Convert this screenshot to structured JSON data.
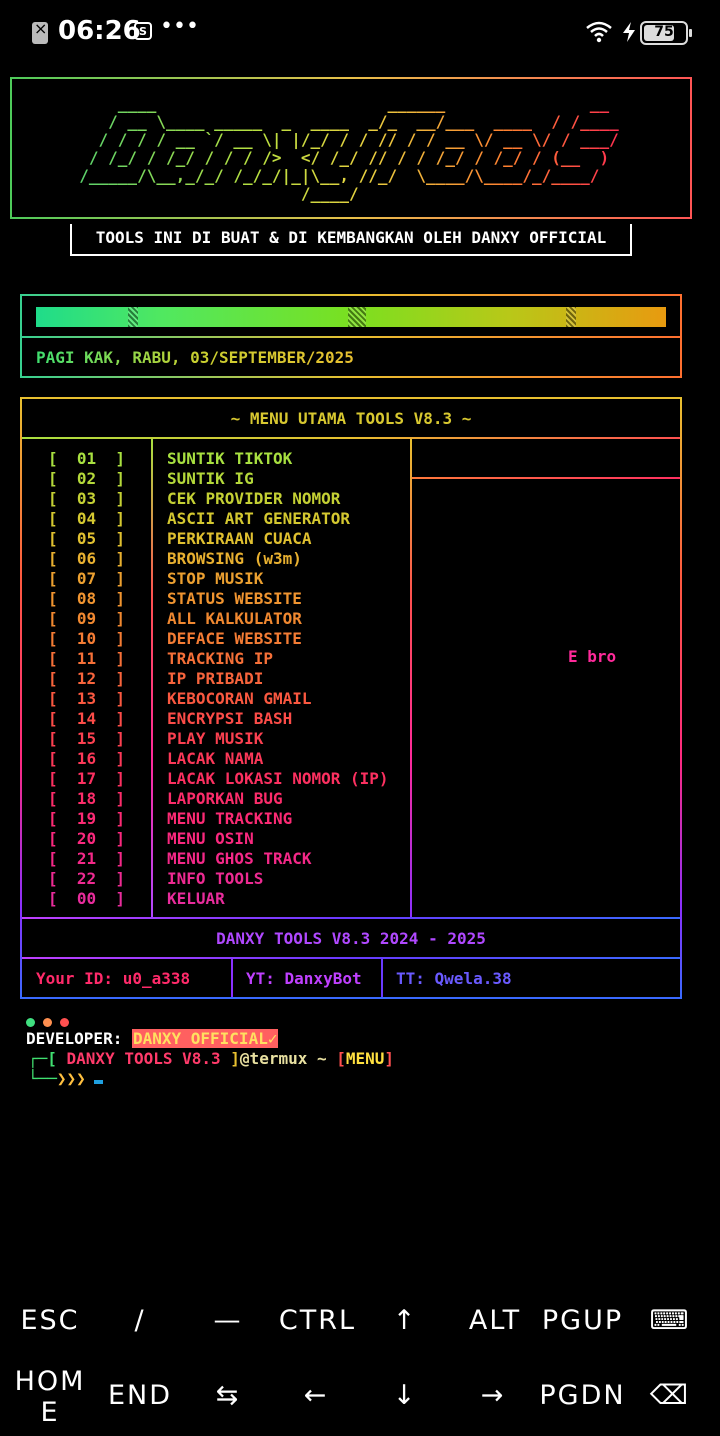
{
  "status_bar": {
    "time": "06:26",
    "more": "•••",
    "battery": "75"
  },
  "banner": {
    "ascii": "      ____                        ______               __\n     / __ \\____ _____  _  ____  _/_  __/___  ____  / /____\n    / / / / __ `/ __ \\| |/_/ / / // / / __ \\/ __ \\/ / ___/\n   / /_/ / /_/ / / / />  </ /_/ // / / /_/ / /_/ / (__  )\n  /_____/\\__,_/_/ /_/_/|_|\\__, //_/  \\____/\\____/_/____/\n                         /____/",
    "credit": "TOOLS INI DI BUAT & DI KEMBANGKAN OLEH DANXY OFFICIAL"
  },
  "greeting": "PAGI KAK, RABU, 03/SEPTEMBER/2025",
  "menu": {
    "title": "~ MENU UTAMA TOOLS V8.3 ~",
    "side_text": "E bro",
    "items": [
      {
        "num": "[  01  ]",
        "label": "SUNTIK TIKTOK",
        "color": "#a8e040"
      },
      {
        "num": "[  02  ]",
        "label": "SUNTIK IG",
        "color": "#b4d83a"
      },
      {
        "num": "[  03  ]",
        "label": "CEK PROVIDER NOMOR",
        "color": "#c4d034"
      },
      {
        "num": "[  04  ]",
        "label": "ASCII ART GENERATOR",
        "color": "#d4c830"
      },
      {
        "num": "[  05  ]",
        "label": "PERKIRAAN CUACA",
        "color": "#e0c030"
      },
      {
        "num": "[  06  ]",
        "label": "BROWSING (w3m)",
        "color": "#e8b030"
      },
      {
        "num": "[  07  ]",
        "label": "STOP MUSIK",
        "color": "#eca030"
      },
      {
        "num": "[  08  ]",
        "label": "STATUS WEBSITE",
        "color": "#f09430"
      },
      {
        "num": "[  09  ]",
        "label": "ALL KALKULATOR",
        "color": "#f08830"
      },
      {
        "num": "[  10  ]",
        "label": "DEFACE WEBSITE",
        "color": "#f47c34"
      },
      {
        "num": "[  11  ]",
        "label": "TRACKING IP",
        "color": "#f67038"
      },
      {
        "num": "[  12  ]",
        "label": "IP PRIBADI",
        "color": "#f8643c"
      },
      {
        "num": "[  13  ]",
        "label": "KEBOCORAN GMAIL",
        "color": "#fa5840"
      },
      {
        "num": "[  14  ]",
        "label": "ENCRYPSI BASH",
        "color": "#fc4c48"
      },
      {
        "num": "[  15  ]",
        "label": "PLAY MUSIK",
        "color": "#fc4050"
      },
      {
        "num": "[  16  ]",
        "label": "LACAK NAMA",
        "color": "#fc3858"
      },
      {
        "num": "[  17  ]",
        "label": "LACAK LOKASI NOMOR (IP)",
        "color": "#fc3060"
      },
      {
        "num": "[  18  ]",
        "label": "LAPORKAN BUG",
        "color": "#fc2c6a"
      },
      {
        "num": "[  19  ]",
        "label": "MENU TRACKING",
        "color": "#fc2a74"
      },
      {
        "num": "[  20  ]",
        "label": "MENU OSIN",
        "color": "#fa287e"
      },
      {
        "num": "[  21  ]",
        "label": "MENU GHOS TRACK",
        "color": "#f42888"
      },
      {
        "num": "[  22  ]",
        "label": "INFO TOOLS",
        "color": "#ee2a92"
      },
      {
        "num": "[  00  ]",
        "label": "KELUAR",
        "color": "#e82c9c"
      }
    ],
    "footer_title": "DANXY TOOLS V8.3 2024 - 2025",
    "footer": {
      "id": "Your ID: u0_a338",
      "yt": "YT: DanxyBot",
      "tt": "TT: Qwela.38"
    }
  },
  "terminal": {
    "dev_label": "DEVELOPER: ",
    "dev_name": "DANXY OFFICIAL✓",
    "prompt_open": "┌─[ ",
    "prompt_tool": "DANXY TOOLS V8.3",
    "prompt_mid": " ]",
    "prompt_host": "@termux ~ ",
    "prompt_lb": "[",
    "prompt_menu": "MENU",
    "prompt_rb": "]",
    "prompt2_corner": "└──",
    "prompt2_arrows": "❯❯❯"
  },
  "keys": {
    "row1": [
      "ESC",
      "/",
      "—",
      "CTRL",
      "↑",
      "ALT",
      "PGUP",
      "⌨"
    ],
    "row2": [
      "HOME",
      "END",
      "⇆",
      "←",
      "↓",
      "→",
      "PGDN",
      "⌫"
    ]
  },
  "colors": {
    "accent_green": "#40e070",
    "accent_yellow": "#e8c030",
    "accent_pink": "#ff2a9a",
    "accent_purple": "#b048ff",
    "accent_blue": "#3a6aff"
  }
}
